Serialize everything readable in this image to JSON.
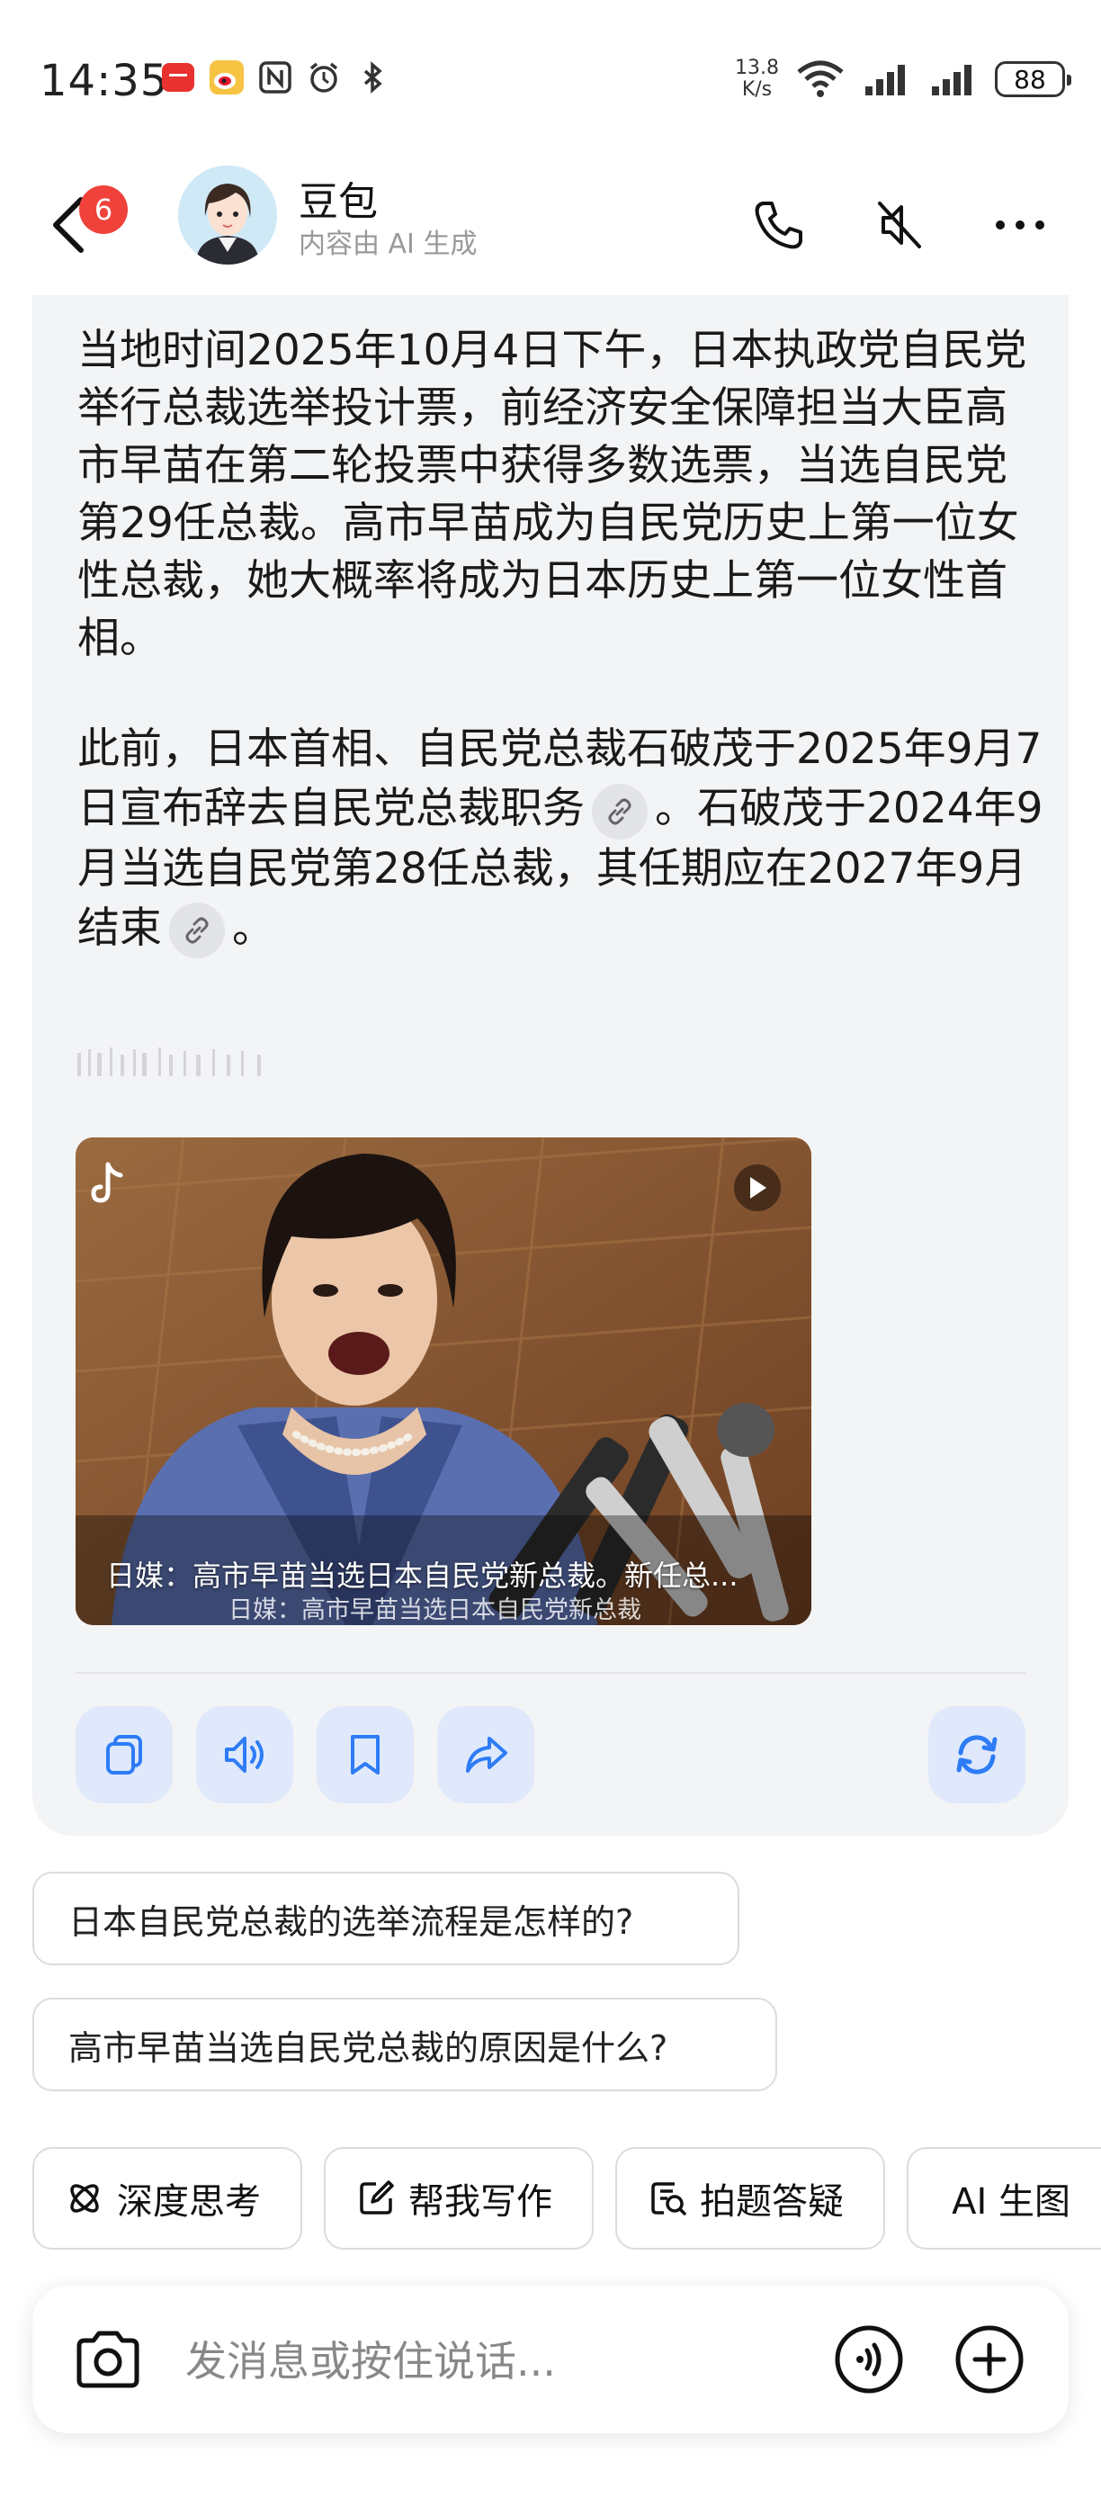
{
  "status_bar": {
    "time": "14:35",
    "net_speed_value": "13.8",
    "net_speed_unit": "K/s",
    "battery": "88",
    "left_icons": [
      "huawei-store-icon",
      "weibo-icon",
      "nfc-icon",
      "alarm-icon",
      "bluetooth-icon"
    ]
  },
  "header": {
    "unread_count": "6",
    "bot_name": "豆包",
    "bot_subtitle": "内容由 AI 生成"
  },
  "answer": {
    "paragraph1": "当地时间2025年10月4日下午，日本执政党自民党举行总裁选举投计票，前经济安全保障担当大臣高市早苗在第二轮投票中获得多数选票，当选自民党第29任总裁。高市早苗成为自民党历史上第一位女性总裁，她大概率将成为日本历史上第一位女性首相。",
    "paragraph2_part1": "此前，日本首相、自民党总裁石破茂于2025年9月7日宣布辞去自民党总裁职务",
    "paragraph2_part2": "。石破茂于2024年9月当选自民党第28任总裁，其任期应在2027年9月结束",
    "paragraph2_part3": "。",
    "video": {
      "caption": "日媒：高市早苗当选日本自民党新总裁。新任总...",
      "subtitle": "日媒：高市早苗当选日本自民党新总裁"
    }
  },
  "suggestions": [
    "日本自民党总裁的选举流程是怎样的?",
    "高市早苗当选自民党总裁的原因是什么?"
  ],
  "tools": [
    {
      "label": "深度思考",
      "icon": "atom-icon"
    },
    {
      "label": "帮我写作",
      "icon": "edit-icon"
    },
    {
      "label": "拍题答疑",
      "icon": "scan-question-icon"
    },
    {
      "label": "AI 生图",
      "icon": "sparkle-icon"
    }
  ],
  "input": {
    "placeholder": "发消息或按住说话..."
  },
  "colors": {
    "accent": "#2e7cf6",
    "action_bg": "#dfe9fb",
    "badge": "#f0413b",
    "card_bg": "#f3f4f6"
  }
}
